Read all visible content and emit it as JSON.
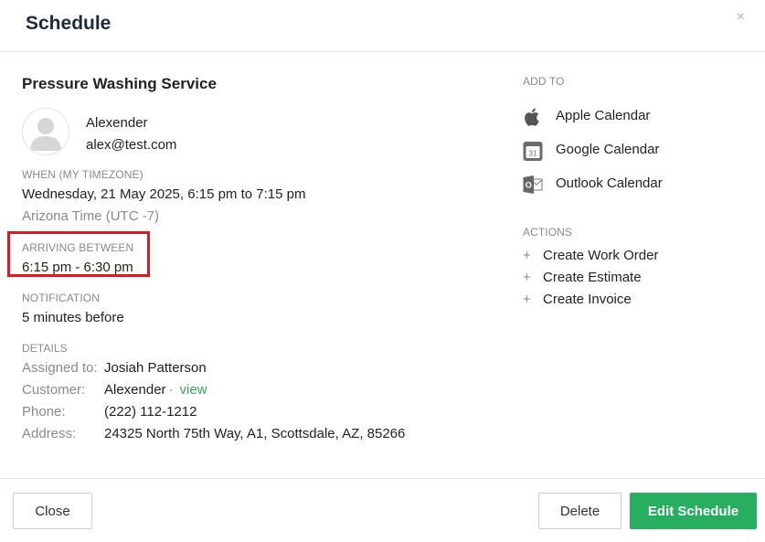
{
  "header": {
    "title": "Schedule",
    "close_glyph": "×"
  },
  "service": {
    "title": "Pressure Washing Service"
  },
  "contact": {
    "name": "Alexender",
    "email": "alex@test.com"
  },
  "when": {
    "label": "WHEN (MY TIMEZONE)",
    "datetime": "Wednesday, 21 May 2025, 6:15 pm to 7:15 pm",
    "timezone": "Arizona Time (UTC -7)"
  },
  "arriving": {
    "label": "ARRIVING BETWEEN",
    "value": "6:15 pm - 6:30 pm",
    "highlight_color": "#e0181f"
  },
  "notification": {
    "label": "NOTIFICATION",
    "value": "5 minutes before"
  },
  "details": {
    "label": "DETAILS",
    "assigned_label": "Assigned to:",
    "assigned_value": "Josiah Patterson",
    "customer_label": "Customer:",
    "customer_value": "Alexender",
    "customer_sep": "·",
    "customer_link": "view",
    "phone_label": "Phone:",
    "phone_value": "(222) 112-1212",
    "address_label": "Address:",
    "address_value": "24325 North 75th Way, A1, Scottsdale, AZ, 85266"
  },
  "add_to": {
    "label": "ADD TO",
    "items": [
      {
        "label": "Apple Calendar",
        "icon": "apple-icon"
      },
      {
        "label": "Google Calendar",
        "icon": "google-calendar-icon",
        "icon_text": "31"
      },
      {
        "label": "Outlook Calendar",
        "icon": "outlook-icon",
        "icon_text": "O"
      }
    ]
  },
  "actions": {
    "label": "ACTIONS",
    "plus": "+",
    "items": [
      {
        "label": "Create Work Order"
      },
      {
        "label": "Create Estimate"
      },
      {
        "label": "Create Invoice"
      }
    ]
  },
  "footer": {
    "close_label": "Close",
    "delete_label": "Delete",
    "edit_label": "Edit Schedule",
    "accent_color": "#27ae5f"
  }
}
